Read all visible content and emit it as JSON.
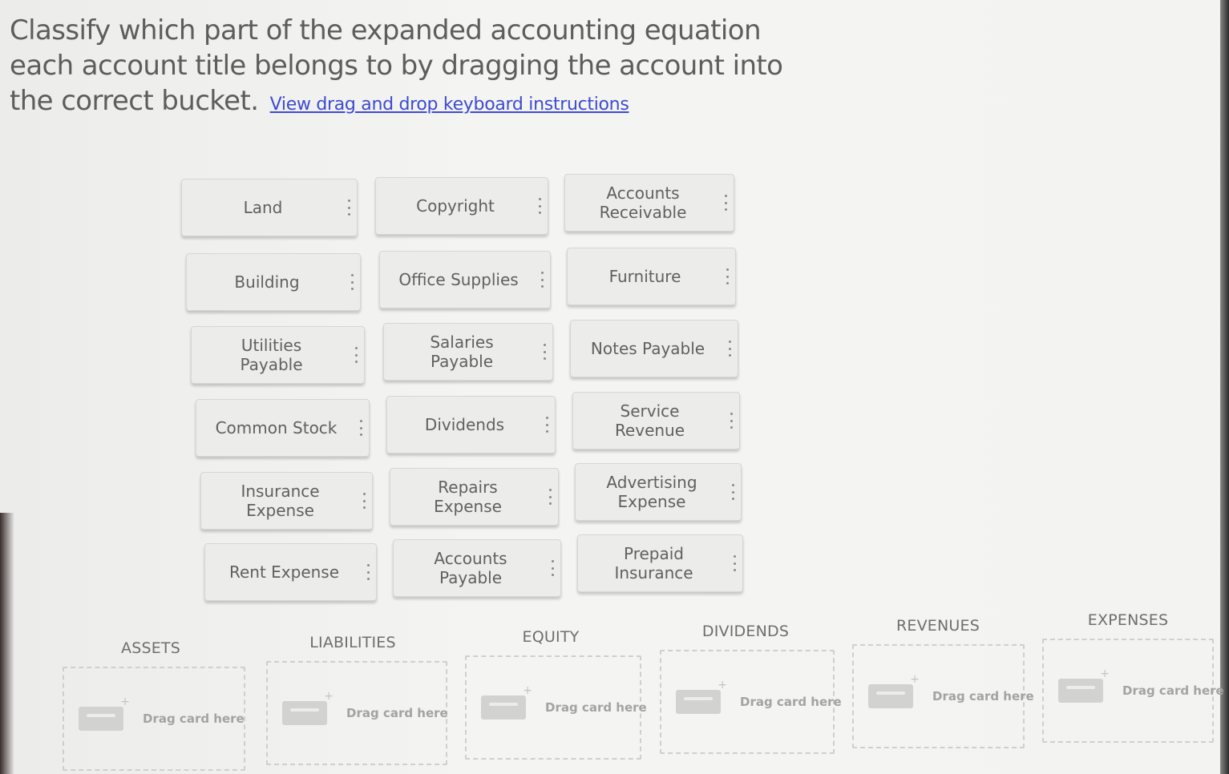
{
  "instructions": {
    "text": "Classify which part of the expanded accounting equation each account title belongs to by dragging the account into the correct bucket.",
    "link": "View drag and drop keyboard instructions"
  },
  "cards": [
    {
      "label": "Land"
    },
    {
      "label": "Copyright"
    },
    {
      "label": "Accounts\nReceivable"
    },
    {
      "label": "Building"
    },
    {
      "label": "Office Supplies"
    },
    {
      "label": "Furniture"
    },
    {
      "label": "Utilities\nPayable"
    },
    {
      "label": "Salaries\nPayable"
    },
    {
      "label": "Notes Payable"
    },
    {
      "label": "Common Stock"
    },
    {
      "label": "Dividends"
    },
    {
      "label": "Service\nRevenue"
    },
    {
      "label": "Insurance\nExpense"
    },
    {
      "label": "Repairs\nExpense"
    },
    {
      "label": "Advertising\nExpense"
    },
    {
      "label": "Rent Expense"
    },
    {
      "label": "Accounts\nPayable"
    },
    {
      "label": "Prepaid\nInsurance"
    }
  ],
  "buckets": [
    {
      "title": "ASSETS",
      "hint": "Drag card here"
    },
    {
      "title": "LIABILITIES",
      "hint": "Drag card here"
    },
    {
      "title": "EQUITY",
      "hint": "Drag card here"
    },
    {
      "title": "DIVIDENDS",
      "hint": "Drag card here"
    },
    {
      "title": "REVENUES",
      "hint": "Drag card here"
    },
    {
      "title": "EXPENSES",
      "hint": "Drag card here"
    }
  ],
  "colors": {
    "link": "#3d4bd1",
    "card_bg": "#ececea",
    "text": "#5d5d5d"
  }
}
